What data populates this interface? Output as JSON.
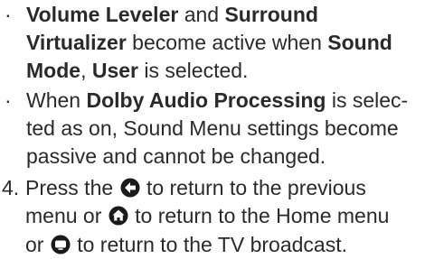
{
  "bullets": [
    {
      "parts": [
        {
          "text": "Volume Leveler",
          "bold": true
        },
        {
          "text": " and ",
          "bold": false
        },
        {
          "text": "Surround Virtualizer",
          "bold": true
        },
        {
          "text": " become active when ",
          "bold": false
        },
        {
          "text": "Sound Mode",
          "bold": true
        },
        {
          "text": ", ",
          "bold": false
        },
        {
          "text": "User",
          "bold": true
        },
        {
          "text": " is selected.",
          "bold": false
        }
      ]
    },
    {
      "parts": [
        {
          "text": "When ",
          "bold": false
        },
        {
          "text": "Dolby Audio Processing",
          "bold": true
        },
        {
          "text": " is selec-ted as on, Sound Menu settings become passive and cannot be changed.",
          "bold": false
        }
      ]
    }
  ],
  "bullet_symbol": "·",
  "step": {
    "number": "4.",
    "line1_a": "Press the",
    "line1_b": "to return to the previous",
    "line2_a": "menu or",
    "line2_b": "to return to the Home menu",
    "line3_a": "or",
    "line3_b": "to return to the TV broadcast."
  },
  "icons": {
    "back": "back-arrow-icon",
    "home": "home-icon",
    "tv": "tv-icon"
  },
  "colors": {
    "text": "#2a2a2a",
    "icon": "#1a1a1a"
  }
}
